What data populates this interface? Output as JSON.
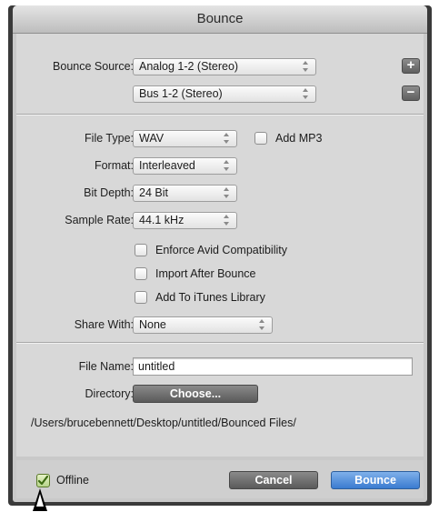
{
  "window": {
    "title": "Bounce"
  },
  "bounce_source": {
    "label": "Bounce Source:",
    "primary": "Analog 1-2 (Stereo)",
    "secondary": "Bus 1-2 (Stereo)",
    "add_label": "+",
    "remove_label": "−"
  },
  "file_type": {
    "label": "File Type:",
    "value": "WAV",
    "add_mp3_label": "Add MP3",
    "add_mp3_checked": false
  },
  "format": {
    "label": "Format:",
    "value": "Interleaved"
  },
  "bit_depth": {
    "label": "Bit Depth:",
    "value": "24 Bit"
  },
  "sample_rate": {
    "label": "Sample Rate:",
    "value": "44.1 kHz"
  },
  "options": [
    {
      "label": "Enforce Avid Compatibility",
      "checked": false
    },
    {
      "label": "Import After Bounce",
      "checked": false
    },
    {
      "label": "Add To iTunes Library",
      "checked": false
    }
  ],
  "share_with": {
    "label": "Share With:",
    "value": "None"
  },
  "file_name": {
    "label": "File Name:",
    "value": "untitled"
  },
  "directory": {
    "label": "Directory:",
    "choose_label": "Choose...",
    "path": "/Users/brucebennett/Desktop/untitled/Bounced Files/"
  },
  "footer": {
    "offline_label": "Offline",
    "offline_checked": true,
    "cancel_label": "Cancel",
    "bounce_label": "Bounce"
  },
  "colors": {
    "bounce_button": "#3a7bd0",
    "offline_check": "#b7d58a"
  }
}
